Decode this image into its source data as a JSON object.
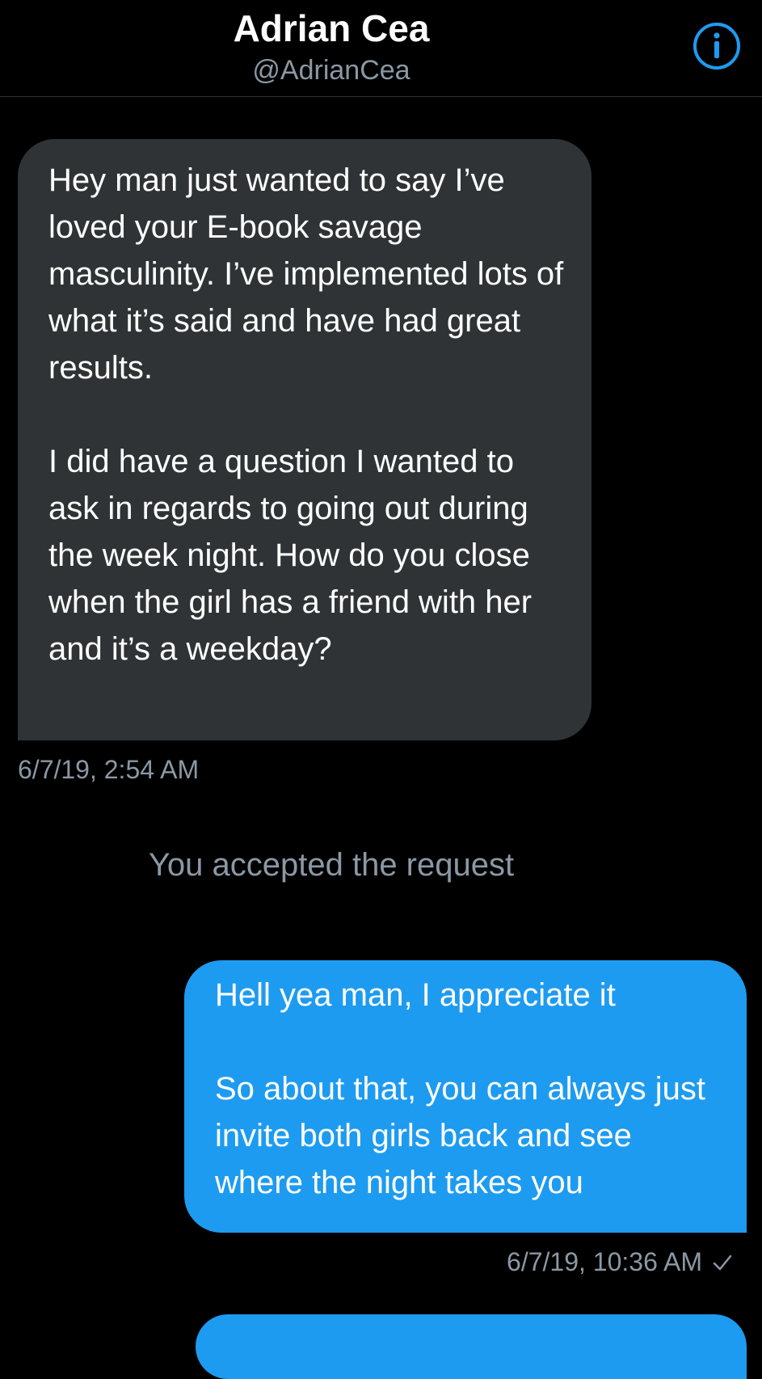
{
  "header": {
    "name": "Adrian Cea",
    "handle": "@AdrianCea",
    "info_icon": "info-icon"
  },
  "messages": [
    {
      "direction": "incoming",
      "text": "Hey man just wanted to say I’ve loved your E-book savage masculinity. I’ve implemented lots of what it’s said and have had great results.\n\nI did have a question I wanted to ask in regards to going out during the week night. How do you close when the girl has a friend with her and it’s a weekday?",
      "timestamp": "6/7/19, 2:54 AM"
    },
    {
      "direction": "system",
      "text": "You accepted the request"
    },
    {
      "direction": "outgoing",
      "text": "Hell yea man, I appreciate it\n\nSo about that, you can always just invite both girls back and see where the night takes you",
      "timestamp": "6/7/19, 10:36 AM",
      "status_icon": "check-icon"
    }
  ],
  "colors": {
    "background": "#000000",
    "incoming_bubble": "#2f3336",
    "outgoing_bubble": "#1d9bf0",
    "secondary_text": "#8b98a5",
    "accent": "#1d9bf0"
  }
}
